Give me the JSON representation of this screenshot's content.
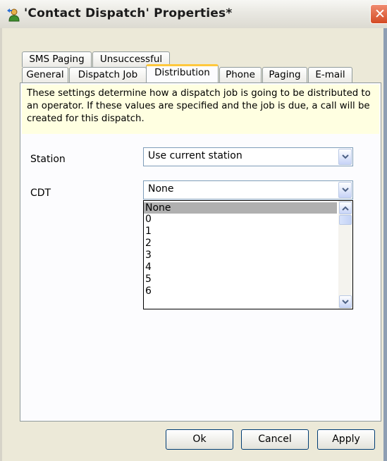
{
  "window": {
    "title": "'Contact Dispatch' Properties*",
    "close_symbol": "✕"
  },
  "tabs": {
    "row1": [
      "SMS Paging",
      "Unsuccessful"
    ],
    "row2": [
      "General",
      "Dispatch Job",
      "Distribution",
      "Phone",
      "Paging",
      "E-mail"
    ],
    "active": "Distribution"
  },
  "info_text": "These settings determine how a dispatch job is going to be distributed to an operator.  If these values are specified and the job is due, a call will be created for this dispatch.",
  "fields": {
    "station_label": "Station",
    "station_value": "Use current station",
    "cdt_label": "CDT",
    "cdt_value": "None"
  },
  "dropdown": {
    "options": [
      "None",
      "0",
      "1",
      "2",
      "3",
      "4",
      "5",
      "6"
    ],
    "selected": "None"
  },
  "buttons": {
    "ok": "Ok",
    "cancel": "Cancel",
    "apply": "Apply"
  },
  "colors": {
    "accent_tab": "#ffc83c",
    "info_background": "#ffffe1",
    "dialog_background": "#ece9d8"
  },
  "icons": [
    "contact-user-icon",
    "close-icon",
    "chevron-down-icon",
    "scroll-up-icon",
    "scroll-down-icon"
  ]
}
